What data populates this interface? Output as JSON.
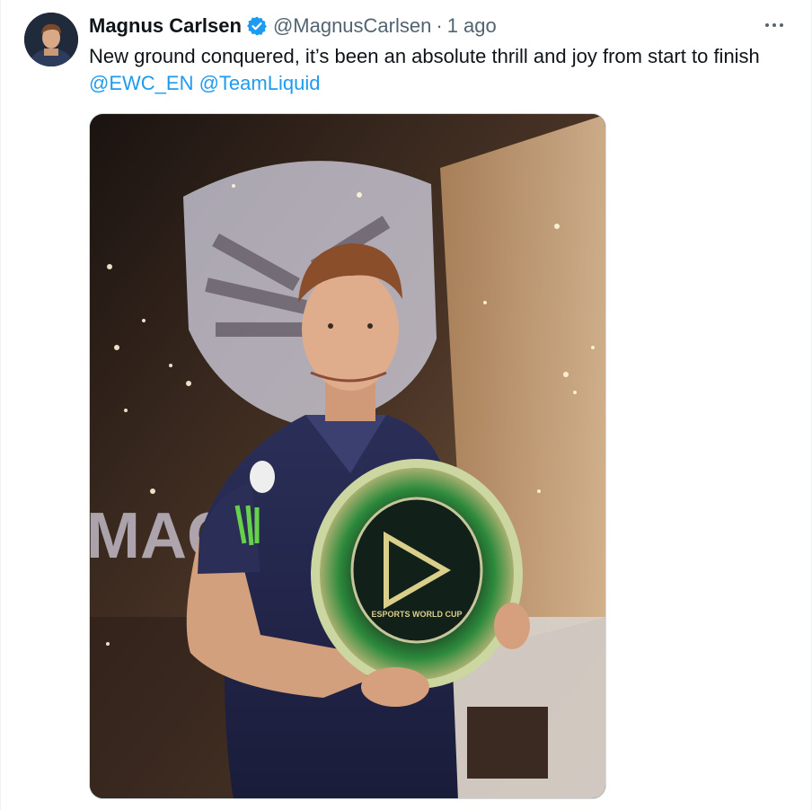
{
  "tweet": {
    "author": {
      "display_name": "Magnus Carlsen",
      "handle": "@MagnusCarlsen",
      "verified": true,
      "avatar_icon": "avatar-photo"
    },
    "separator": "·",
    "time": "1 ago",
    "more_icon": "more-horizontal-icon",
    "text": {
      "body": "New ground conquered, it’s been an absolute thrill and joy from start to finish ",
      "mentions": [
        "@EWC_EN",
        "@TeamLiquid"
      ]
    },
    "media": {
      "type": "photo",
      "backdrop_text": "MAGN",
      "trophy_text": "ESPORTS WORLD CUP"
    }
  },
  "colors": {
    "link": "#1d9bf0",
    "secondary_text": "#536471",
    "verified_badge": "#1d9bf0"
  }
}
